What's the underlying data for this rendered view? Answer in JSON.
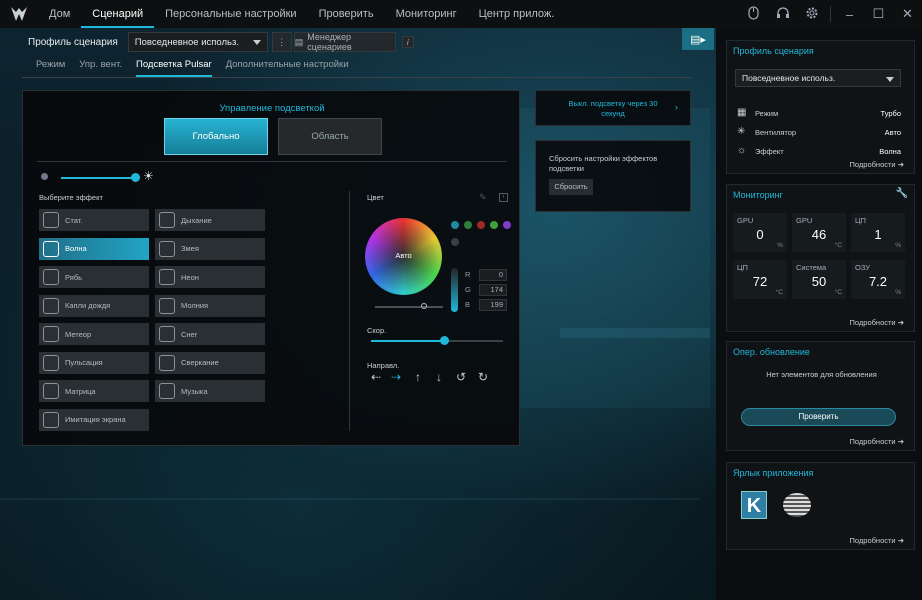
{
  "nav": {
    "items": [
      "Дом",
      "Сценарий",
      "Персональные настройки",
      "Проверить",
      "Мониторинг",
      "Центр прилож."
    ],
    "active": 1
  },
  "profile": {
    "label": "Профиль сценария",
    "value": "Повседневное использ.",
    "manager": "Менеджер сценариев"
  },
  "subtabs": {
    "items": [
      "Режим",
      "Упр. вент.",
      "Подсветка Pulsar",
      "Дополнительные настройки"
    ],
    "active": 2
  },
  "lighting": {
    "title": "Управление подсветкой",
    "global": "Глобально",
    "area": "Область",
    "brightness_pct": 100,
    "choose_effect": "Выберите эффект"
  },
  "effects": [
    {
      "label": "Стат.",
      "selected": false
    },
    {
      "label": "Дыхание",
      "selected": false
    },
    {
      "label": "Волна",
      "selected": true
    },
    {
      "label": "Змея",
      "selected": false
    },
    {
      "label": "Рябь",
      "selected": false
    },
    {
      "label": "Неон",
      "selected": false
    },
    {
      "label": "Капли дождя",
      "selected": false
    },
    {
      "label": "Молния",
      "selected": false
    },
    {
      "label": "Метеор",
      "selected": false
    },
    {
      "label": "Снег",
      "selected": false
    },
    {
      "label": "Пульсация",
      "selected": false
    },
    {
      "label": "Сверкание",
      "selected": false
    },
    {
      "label": "Матрица",
      "selected": false
    },
    {
      "label": "Музыка",
      "selected": false
    },
    {
      "label": "Имитация экрана",
      "selected": false
    }
  ],
  "color": {
    "label": "Цвет",
    "wheel_center": "Авто",
    "r_label": "R",
    "g_label": "G",
    "b_label": "B",
    "r": "0",
    "g": "174",
    "b": "199",
    "swatches": [
      "#1f8a9f",
      "#2e7d3c",
      "#a02828",
      "#3fa03a",
      "#7d3fc8",
      "#3a3f44"
    ]
  },
  "speed": {
    "label": "Скор.",
    "value_pct": 55
  },
  "direction": {
    "label": "Направл."
  },
  "side_actions": {
    "off_after": "Выкл. подсветку через 30 секунд",
    "reset_text": "Сбросить настройки эффектов подсветки",
    "reset_btn": "Сбросить"
  },
  "right": {
    "scenario": {
      "title": "Профиль сценария",
      "profile": "Повседневное использ.",
      "rows": [
        {
          "k": "Режим",
          "v": "Турбо"
        },
        {
          "k": "Вентилятор",
          "v": "Авто"
        },
        {
          "k": "Эффект",
          "v": "Волна"
        }
      ],
      "more": "Подробности"
    },
    "monitor": {
      "title": "Мониторинг",
      "cells": [
        {
          "l": "GPU",
          "v": "0",
          "u": "%"
        },
        {
          "l": "GPU",
          "v": "46",
          "u": "°C"
        },
        {
          "l": "ЦП",
          "v": "1",
          "u": "%"
        },
        {
          "l": "ЦП",
          "v": "72",
          "u": "°C"
        },
        {
          "l": "Система",
          "v": "50",
          "u": "°C"
        },
        {
          "l": "ОЗУ",
          "v": "7.2",
          "u": "%"
        }
      ],
      "more": "Подробности"
    },
    "update": {
      "title": "Опер. обновление",
      "empty": "Нет элементов для обновления",
      "btn": "Проверить",
      "more": "Подробности"
    },
    "shortcuts": {
      "title": "Ярлык приложения",
      "app1": "K",
      "more": "Подробности"
    }
  },
  "colors": {
    "accent": "#20b8d9"
  }
}
